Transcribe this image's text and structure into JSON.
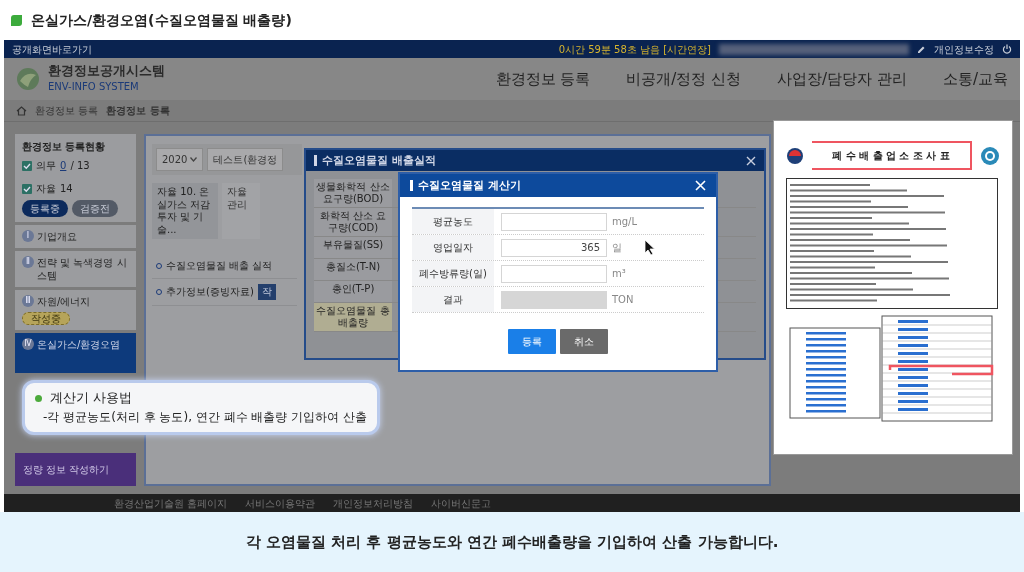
{
  "page_title": "온실가스/환경오염(수질오염물질 배출량)",
  "top_bar": {
    "shortcut": "공개화면바로가기",
    "timer": "0시간 59분 58초 남음 [시간연장]",
    "profile_edit": "개인정보수정"
  },
  "header": {
    "logo_title": "환경정보공개시스템",
    "logo_subtitle": "ENV-INFO SYSTEM",
    "menu": [
      {
        "label": "환경정보 등록"
      },
      {
        "label": "비공개/정정 신청"
      },
      {
        "label": "사업장/담당자 관리"
      },
      {
        "label": "소통/교육"
      }
    ]
  },
  "breadcrumb": [
    "환경정보 등록",
    "환경정보 등록"
  ],
  "sidebar": {
    "status_title": "환경정보 등록현황",
    "counts": [
      {
        "label": "의무",
        "value": "0",
        "total": "/ 13",
        "checked": true,
        "linked": true
      },
      {
        "label": "자율",
        "value": "14",
        "checked": true,
        "linked": false
      }
    ],
    "pills": [
      {
        "label": "등록중",
        "kind": "primary"
      },
      {
        "label": "검증전",
        "kind": "secondary"
      }
    ],
    "sections": [
      {
        "numeral": "Ⅰ",
        "label": "기업개요",
        "selected": false
      },
      {
        "numeral": "Ⅱ",
        "label": "전략 및 녹색경영 시스템",
        "selected": false
      },
      {
        "numeral": "Ⅲ",
        "label": "자원/에너지",
        "selected": false,
        "badge": "작성중"
      },
      {
        "numeral": "Ⅳ",
        "label": "온실가스/환경오염",
        "selected": true
      }
    ],
    "action": "정량 정보 작성하기"
  },
  "main": {
    "year": "2020",
    "company": "테스트(환경정",
    "tabs": [
      {
        "label": "자율 10. 온실가스 저감투자 및 기술...",
        "selected": true
      },
      {
        "label": "자율 관리",
        "selected": false
      }
    ],
    "rows": [
      {
        "label": "수질오염물질 배출 실적"
      },
      {
        "label": "추가정보(증빙자료)",
        "button": "작"
      }
    ]
  },
  "emission_dialog": {
    "title": "수질오염물질 배출실적",
    "rows": [
      {
        "label": "생물화학적 산소 요구량(BOD)",
        "highlight": false
      },
      {
        "label": "화학적 산소 요구량(COD)",
        "highlight": false
      },
      {
        "label": "부유물질(SS)",
        "highlight": false
      },
      {
        "label": "총질소(T-N)",
        "highlight": false
      },
      {
        "label": "총인(T-P)",
        "highlight": false
      },
      {
        "label": "수질오염물질 총배출량",
        "highlight": true
      }
    ]
  },
  "calculator": {
    "title": "수질오염물질 계산기",
    "rows": [
      {
        "label": "평균농도",
        "unit": "mg/L",
        "disabled": false
      },
      {
        "label": "영업일자",
        "value": "365",
        "unit": "일",
        "disabled": false
      },
      {
        "label": "폐수방류량(일)",
        "unit": "m³",
        "disabled": false
      },
      {
        "label": "결과",
        "unit": "TON",
        "disabled": true
      }
    ],
    "buttons": [
      {
        "label": "등록",
        "kind": "primary"
      },
      {
        "label": "취소",
        "kind": "secondary"
      }
    ]
  },
  "tooltip": {
    "title": "계산기 사용법",
    "text": "-각 평균농도(처리 후 농도), 연간 폐수 배출량 기입하여 산출"
  },
  "document": {
    "title": "폐 수 배 출 업 소 조 사 표"
  },
  "footer": [
    "환경산업기술원 홈페이지",
    "서비스이용약관",
    "개인정보처리방침",
    "사이버신문고"
  ],
  "caption": "각 오염물질 처리 후 평균농도와 연간 폐수배출량을 기입하여 산출 가능합니다."
}
